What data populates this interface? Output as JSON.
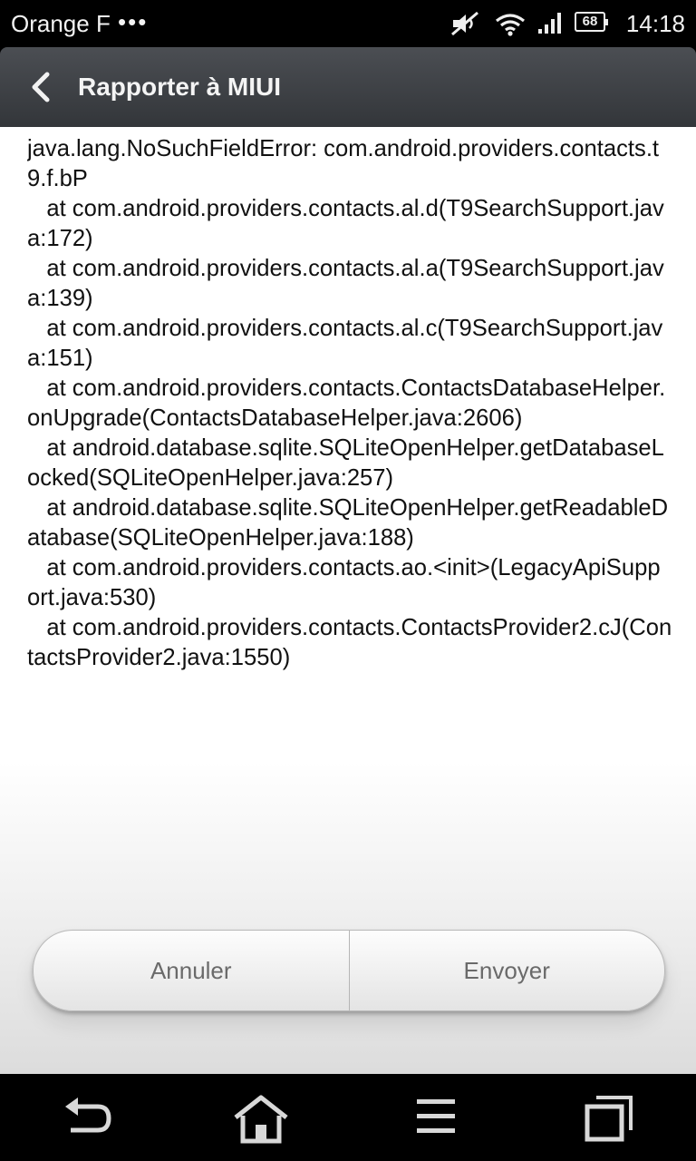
{
  "status_bar": {
    "carrier": "Orange F",
    "more_dots": "•••",
    "battery_level": "68",
    "time": "14:18",
    "icons": [
      "mute-icon",
      "wifi-icon",
      "signal-icon",
      "battery-icon"
    ]
  },
  "header": {
    "title": "Rapporter à MIUI",
    "back_icon": "chevron-left-icon"
  },
  "log": {
    "text": "java.lang.NoSuchFieldError: com.android.providers.contacts.t9.f.bP\n   at com.android.providers.contacts.al.d(T9SearchSupport.java:172)\n   at com.android.providers.contacts.al.a(T9SearchSupport.java:139)\n   at com.android.providers.contacts.al.c(T9SearchSupport.java:151)\n   at com.android.providers.contacts.ContactsDatabaseHelper.onUpgrade(ContactsDatabaseHelper.java:2606)\n   at android.database.sqlite.SQLiteOpenHelper.getDatabaseLocked(SQLiteOpenHelper.java:257)\n   at android.database.sqlite.SQLiteOpenHelper.getReadableDatabase(SQLiteOpenHelper.java:188)\n   at com.android.providers.contacts.ao.<init>(LegacyApiSupport.java:530)\n   at com.android.providers.contacts.ContactsProvider2.cJ(ContactsProvider2.java:1550)"
  },
  "buttons": {
    "cancel_label": "Annuler",
    "send_label": "Envoyer"
  },
  "nav_bar": {
    "icons": [
      "back-arrow-icon",
      "home-icon",
      "menu-icon",
      "recent-apps-icon"
    ]
  }
}
